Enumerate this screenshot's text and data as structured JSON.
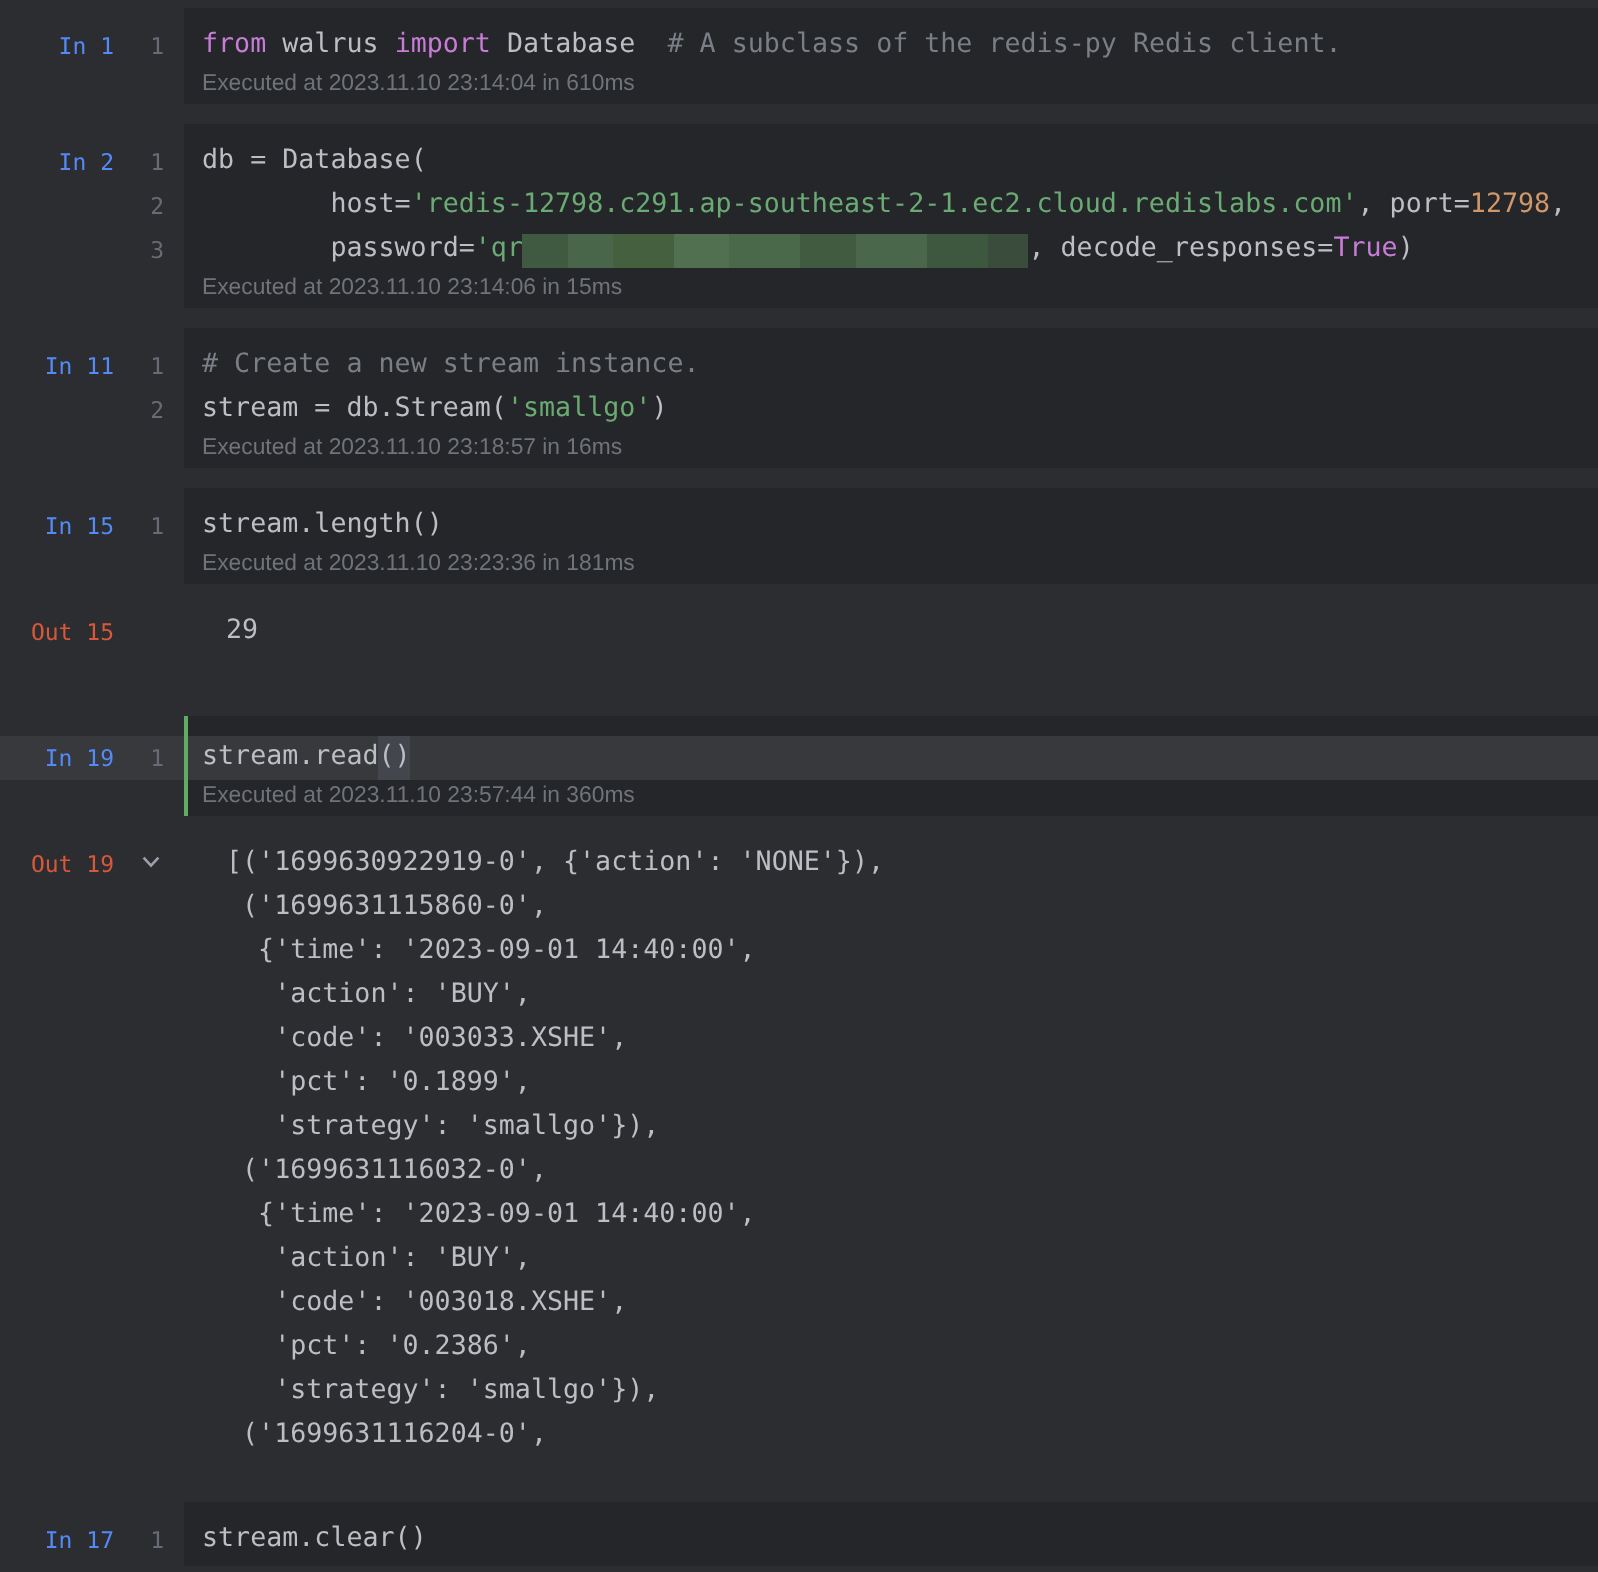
{
  "cells": [
    {
      "label": "In 1",
      "selected": false,
      "lines": [
        {
          "number": "1",
          "tokens": [
            {
              "text": "from",
              "kind": "keyword"
            },
            {
              "text": " walrus ",
              "kind": "plain"
            },
            {
              "text": "import",
              "kind": "keyword"
            },
            {
              "text": " Database  ",
              "kind": "plain"
            },
            {
              "text": "# A subclass of the redis-py Redis client.",
              "kind": "comment"
            }
          ]
        }
      ],
      "executed": "Executed at 2023.11.10 23:14:04 in 610ms"
    },
    {
      "label": "In 2",
      "selected": false,
      "lines": [
        {
          "number": "1",
          "tokens": [
            {
              "text": "db = Database(",
              "kind": "plain"
            }
          ]
        },
        {
          "number": "2",
          "tokens": [
            {
              "text": "        host=",
              "kind": "plain"
            },
            {
              "text": "'redis-12798.c291.ap-southeast-2-1.ec2.cloud.redislabs.com'",
              "kind": "string"
            },
            {
              "text": ", port=",
              "kind": "plain"
            },
            {
              "text": "12798",
              "kind": "number"
            },
            {
              "text": ",",
              "kind": "plain"
            }
          ]
        },
        {
          "number": "3",
          "tokens": [
            {
              "text": "        password=",
              "kind": "plain"
            },
            {
              "text": "'qr",
              "kind": "string"
            },
            {
              "kind": "redacted"
            },
            {
              "text": ", decode_responses=",
              "kind": "plain"
            },
            {
              "text": "True",
              "kind": "keyword"
            },
            {
              "text": ")",
              "kind": "plain"
            }
          ]
        }
      ],
      "executed": "Executed at 2023.11.10 23:14:06 in 15ms"
    },
    {
      "label": "In 11",
      "selected": false,
      "lines": [
        {
          "number": "1",
          "tokens": [
            {
              "text": "# Create a new stream instance.",
              "kind": "comment"
            }
          ]
        },
        {
          "number": "2",
          "tokens": [
            {
              "text": "stream = db.Stream(",
              "kind": "plain"
            },
            {
              "text": "'smallgo'",
              "kind": "string"
            },
            {
              "text": ")",
              "kind": "plain"
            }
          ]
        }
      ],
      "executed": "Executed at 2023.11.10 23:18:57 in 16ms"
    },
    {
      "label": "In 15",
      "selected": false,
      "lines": [
        {
          "number": "1",
          "tokens": [
            {
              "text": "stream.length()",
              "kind": "plain"
            }
          ]
        }
      ],
      "executed": "Executed at 2023.11.10 23:23:36 in 181ms",
      "output": {
        "label": "Out 15",
        "collapsible": false,
        "lines": [
          "29"
        ]
      }
    },
    {
      "label": "In 19",
      "selected": true,
      "lines": [
        {
          "number": "1",
          "tokens": [
            {
              "text": "stream.read",
              "kind": "plain"
            },
            {
              "text": "()",
              "kind": "matched"
            }
          ]
        }
      ],
      "executed": "Executed at 2023.11.10 23:57:44 in 360ms",
      "output": {
        "label": "Out 19",
        "collapsible": true,
        "expanded": true,
        "lines": [
          "[('1699630922919-0', {'action': 'NONE'}),",
          " ('1699631115860-0',",
          "  {'time': '2023-09-01 14:40:00',",
          "   'action': 'BUY',",
          "   'code': '003033.XSHE',",
          "   'pct': '0.1899',",
          "   'strategy': 'smallgo'}),",
          " ('1699631116032-0',",
          "  {'time': '2023-09-01 14:40:00',",
          "   'action': 'BUY',",
          "   'code': '003018.XSHE',",
          "   'pct': '0.2386',",
          "   'strategy': 'smallgo'}),",
          " ('1699631116204-0',"
        ]
      }
    },
    {
      "label": "In 17",
      "selected": false,
      "lines": [
        {
          "number": "1",
          "tokens": [
            {
              "text": "stream.clear()",
              "kind": "plain"
            }
          ]
        }
      ]
    }
  ]
}
